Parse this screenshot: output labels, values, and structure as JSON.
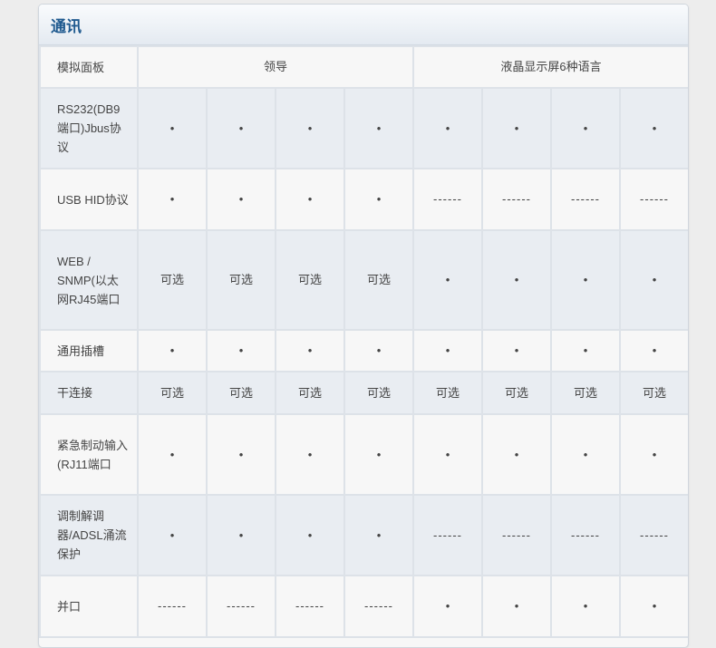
{
  "section": {
    "title": "通讯"
  },
  "header_row": {
    "label": "模拟面板",
    "group1": "领导",
    "group2": "液晶显示屏6种语言"
  },
  "rows": [
    {
      "label": "RS232(DB9端口)Jbus协议",
      "cells": [
        "•",
        "•",
        "•",
        "•",
        "•",
        "•",
        "•",
        "•"
      ]
    },
    {
      "label": "USB HID协议",
      "cells": [
        "•",
        "•",
        "•",
        "•",
        "------",
        "------",
        "------",
        "------"
      ]
    },
    {
      "label": "WEB / SNMP(以太网RJ45端口",
      "cells": [
        "可选",
        "可选",
        "可选",
        "可选",
        "•",
        "•",
        "•",
        "•"
      ]
    },
    {
      "label": "通用插槽",
      "cells": [
        "•",
        "•",
        "•",
        "•",
        "•",
        "•",
        "•",
        "•"
      ]
    },
    {
      "label": "干连接",
      "cells": [
        "可选",
        "可选",
        "可选",
        "可选",
        "可选",
        "可选",
        "可选",
        "可选"
      ]
    },
    {
      "label": "紧急制动输入(RJ11端口",
      "cells": [
        "•",
        "•",
        "•",
        "•",
        "•",
        "•",
        "•",
        "•"
      ]
    },
    {
      "label": "调制解调器/ADSL涌流保护",
      "cells": [
        "•",
        "•",
        "•",
        "•",
        "------",
        "------",
        "------",
        "------"
      ]
    },
    {
      "label": "并口",
      "cells": [
        "------",
        "------",
        "------",
        "------",
        "•",
        "•",
        "•",
        "•"
      ]
    }
  ]
}
